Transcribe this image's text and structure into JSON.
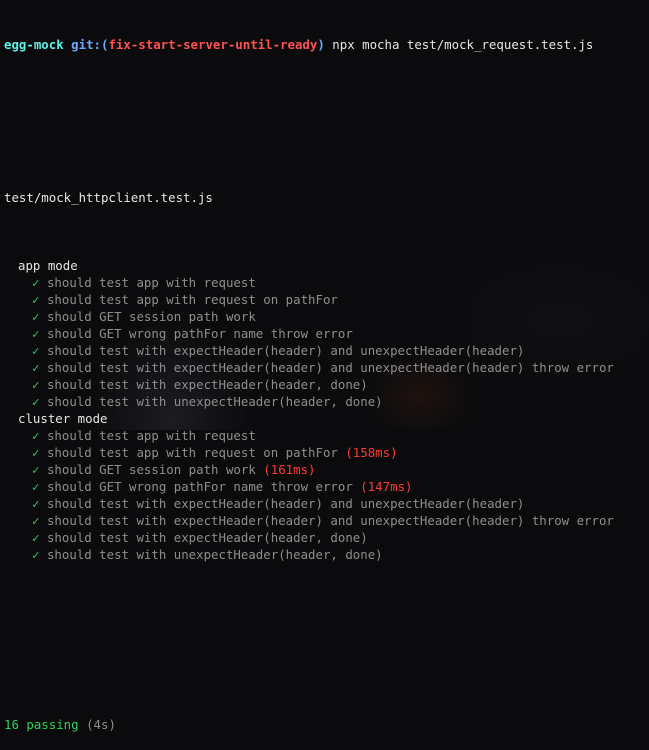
{
  "prompt": {
    "dir": "egg-mock",
    "git_label": "git:",
    "branch_open": "(",
    "branch": "fix-start-server-until-ready",
    "branch_close": ")",
    "command": "npx mocha test/mock_request.test.js"
  },
  "file": "test/mock_httpclient.test.js",
  "suites": [
    {
      "title": "app mode",
      "tests": [
        {
          "label": "should test app with request",
          "time": ""
        },
        {
          "label": "should test app with request on pathFor",
          "time": ""
        },
        {
          "label": "should GET session path work",
          "time": ""
        },
        {
          "label": "should GET wrong pathFor name throw error",
          "time": ""
        },
        {
          "label": "should test with expectHeader(header) and unexpectHeader(header)",
          "time": ""
        },
        {
          "label": "should test with expectHeader(header) and unexpectHeader(header) throw error",
          "time": ""
        },
        {
          "label": "should test with expectHeader(header, done)",
          "time": ""
        },
        {
          "label": "should test with unexpectHeader(header, done)",
          "time": ""
        }
      ]
    },
    {
      "title": "cluster mode",
      "tests": [
        {
          "label": "should test app with request",
          "time": ""
        },
        {
          "label": "should test app with request on pathFor",
          "time": "(158ms)"
        },
        {
          "label": "should GET session path work",
          "time": "(161ms)"
        },
        {
          "label": "should GET wrong pathFor name throw error",
          "time": "(147ms)"
        },
        {
          "label": "should test with expectHeader(header) and unexpectHeader(header)",
          "time": ""
        },
        {
          "label": "should test with expectHeader(header) and unexpectHeader(header) throw error",
          "time": ""
        },
        {
          "label": "should test with expectHeader(header, done)",
          "time": ""
        },
        {
          "label": "should test with unexpectHeader(header, done)",
          "time": ""
        }
      ]
    }
  ],
  "check_glyph": "✓",
  "summary": {
    "passing": "16 passing",
    "duration": "(4s)"
  },
  "colors": {
    "dir": "#5ef2e7",
    "git": "#6ea8ff",
    "branch": "#ff5252",
    "check": "#2fd35b",
    "test": "#8e8e8e",
    "slow": "#ff3b30"
  }
}
